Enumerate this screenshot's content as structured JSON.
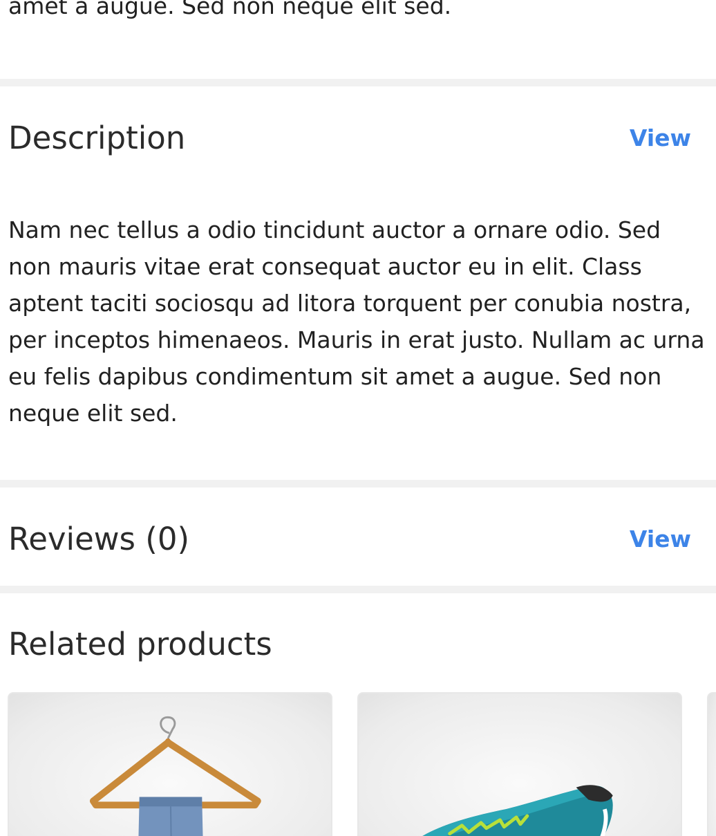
{
  "prev_section": {
    "text_tail": "amet a augue. Sed non neque elit sed."
  },
  "description": {
    "title": "Description",
    "view_label": "View",
    "body": "Nam nec tellus a odio tincidunt auctor a ornare odio. Sed non mauris vitae erat consequat auctor eu in elit. Class aptent taciti sociosqu ad litora torquent per conubia nostra, per inceptos himenaeos. Mauris in erat justo. Nullam ac urna eu felis dapibus condimentum sit amet a augue. Sed non neque elit sed."
  },
  "reviews": {
    "title": "Reviews (0)",
    "view_label": "View"
  },
  "related": {
    "title": "Related products",
    "products": [
      {
        "image": "hanger-with-jeans"
      },
      {
        "image": "teal-running-shoe"
      },
      {
        "image": "product-image"
      }
    ]
  },
  "colors": {
    "link": "#3d84e8",
    "divider": "#f1f1f1",
    "text": "#212121"
  }
}
